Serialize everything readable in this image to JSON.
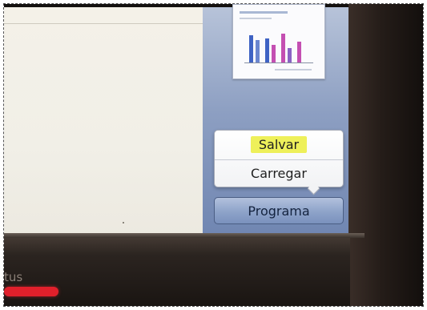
{
  "menu": {
    "save_label": "Salvar",
    "load_label": "Carregar"
  },
  "program_button_label": "Programa",
  "bezel": {
    "status_label": "tus"
  },
  "colors": {
    "highlight": "#eef05a",
    "status_led": "#e0202b",
    "sidebar": "#8d9fc2"
  },
  "thumbnail": {
    "icon": "chart-thumbnail"
  }
}
